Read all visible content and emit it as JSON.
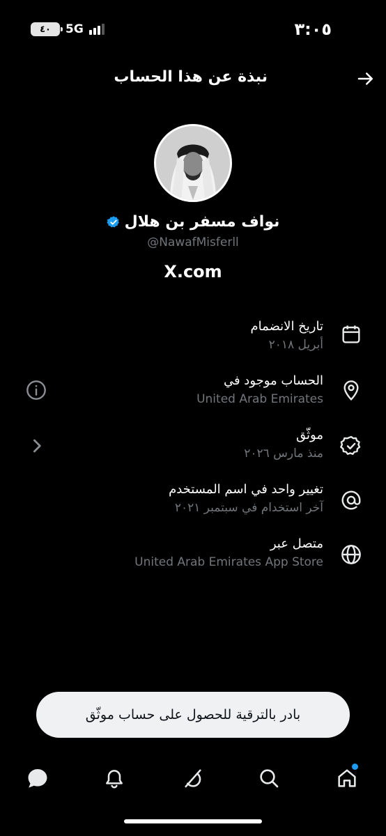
{
  "status_bar": {
    "time": "٣:٠٥",
    "battery": "٤٠",
    "network": "5G"
  },
  "header": {
    "title": "نبذة عن هذا الحساب"
  },
  "profile": {
    "name": "نواف مسفر بن هلال",
    "handle": "@NawafMisferll",
    "site": "X.com",
    "verified_color": "#1d9bf0"
  },
  "info": [
    {
      "icon": "calendar-icon",
      "label": "تاريخ الانضمام",
      "sub": "أبريل ٢٠١٨"
    },
    {
      "icon": "location-pin-icon",
      "label": "الحساب موجود في",
      "sub": "United Arab Emirates",
      "side_icon": "info-icon"
    },
    {
      "icon": "verified-badge-icon",
      "label": "موثّق",
      "sub": "منذ مارس ٢٠٢٦",
      "side_icon": "chevron-left-icon"
    },
    {
      "icon": "at-sign-icon",
      "label": "تغيير واحد في اسم المستخدم",
      "sub": "آخر استخدام في سبتمبر ٢٠٢١"
    },
    {
      "icon": "globe-icon",
      "label": "متصل عبر",
      "sub": "United Arab Emirates App Store"
    }
  ],
  "upgrade_banner": {
    "label": "بادر بالترقية للحصول على حساب موثّق"
  },
  "bottom_nav": {
    "items": [
      "messages-icon",
      "notifications-icon",
      "grok-icon",
      "search-icon",
      "home-icon"
    ],
    "active": "home-icon",
    "notification_dot_color": "#1d9bf0"
  }
}
